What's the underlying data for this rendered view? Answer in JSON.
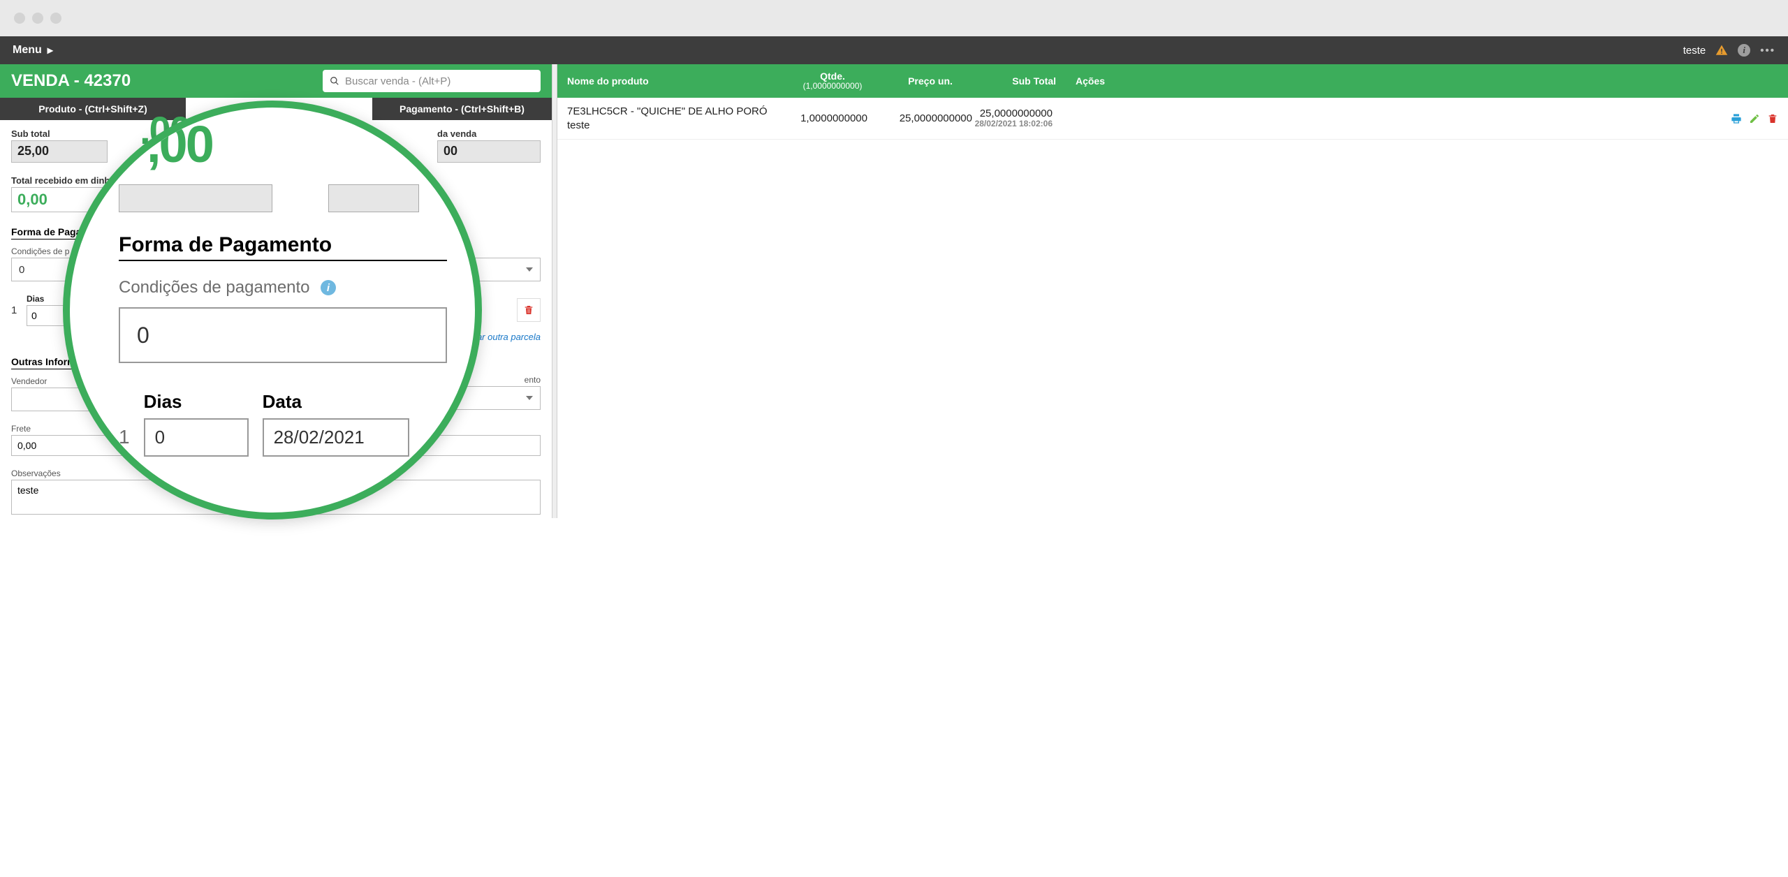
{
  "chrome": {
    "dots": 3
  },
  "topnav": {
    "menu_label": "Menu",
    "user_label": "teste"
  },
  "left": {
    "title": "VENDA - 42370",
    "search_placeholder": "Buscar venda - (Alt+P)",
    "tab_produto": "Produto - (Ctrl+Shift+Z)",
    "tab_pagamento": "Pagamento - (Ctrl+Shift+B)",
    "big_total_fragment": ",00",
    "sub_total_label": "Sub total",
    "sub_total_value": "25,00",
    "venda_label_fragment": "da venda",
    "venda_value_fragment": "00",
    "recebido_label": "Total recebido em dinhe",
    "recebido_value": "0,00",
    "forma_pag_title": "Forma de Paga",
    "condicoes_label": "Condições de p",
    "condicoes_value": "0",
    "parcela": {
      "num": "1",
      "dias_label": "Dias",
      "dias_value": "0"
    },
    "add_parcela": "ar outra parcela",
    "outras_info_title": "Outras Informa",
    "vendedor_label": "Vendedor",
    "vendedor_value": "",
    "right_dropdown_label_fragment": "ento",
    "frete_label": "Frete",
    "frete_value": "0,00",
    "obs_label": "Observações",
    "obs_value": "teste"
  },
  "right": {
    "hdr_nome": "Nome do produto",
    "hdr_qtde": "Qtde.",
    "hdr_qtde_sub": "(1,0000000000)",
    "hdr_preco": "Preço un.",
    "hdr_subtotal": "Sub Total",
    "hdr_acoes": "Ações",
    "rows": [
      {
        "name": "7E3LHC5CR - \"QUICHE\" DE ALHO PORÓ teste",
        "qty": "1,0000000000",
        "price": "25,0000000000",
        "subtotal": "25,0000000000",
        "date": "28/02/2021 18:02:06"
      }
    ]
  },
  "magnifier": {
    "forma_title": "Forma de Pagamento",
    "cond_label": "Condições de pagamento",
    "cond_value": "0",
    "dias_label": "Dias",
    "dias_value": "0",
    "data_label": "Data",
    "data_value": "28/02/2021",
    "num": "1",
    "big_num_fragment": ",00"
  }
}
